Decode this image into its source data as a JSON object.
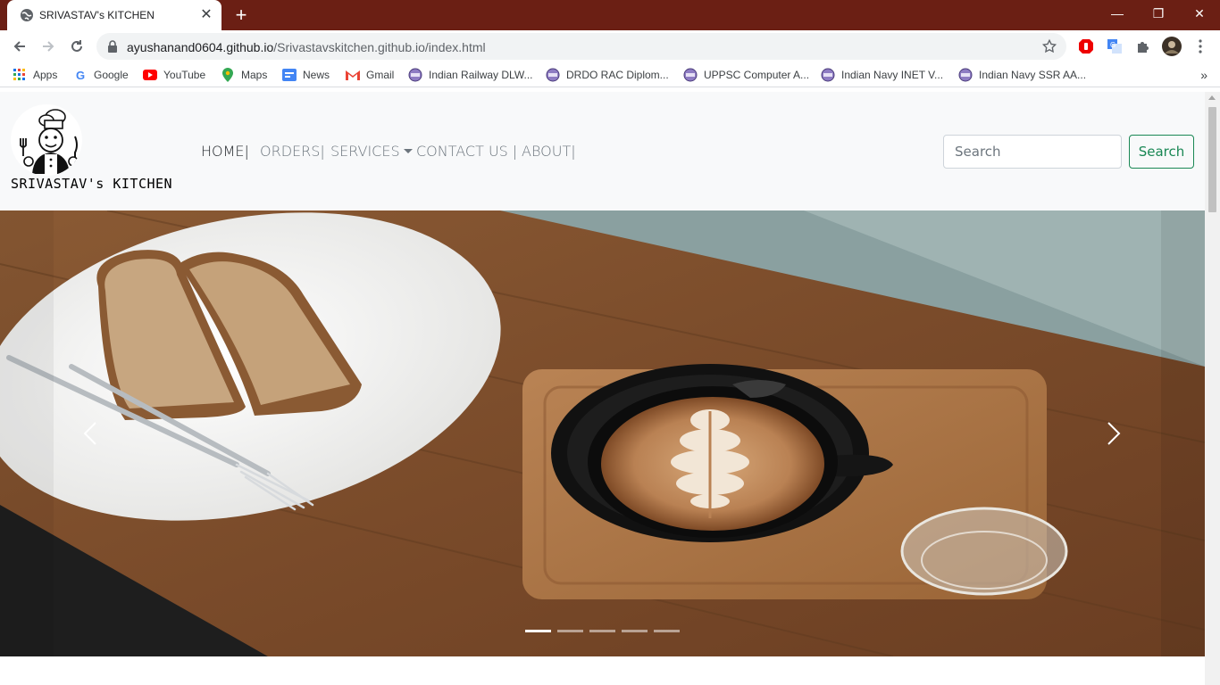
{
  "browser": {
    "tab_title": "SRIVASTAV's KITCHEN",
    "tab_close": "✕",
    "new_tab": "+",
    "url_host": "ayushanand0604.github.io",
    "url_path": "/Srivastavskitchen.github.io/index.html",
    "window_controls": [
      "—",
      "❐",
      "✕"
    ]
  },
  "bookmarks": [
    {
      "label": "Apps",
      "icon": "apps-grid-icon"
    },
    {
      "label": "Google",
      "icon": "google-icon"
    },
    {
      "label": "YouTube",
      "icon": "youtube-icon"
    },
    {
      "label": "Maps",
      "icon": "maps-icon"
    },
    {
      "label": "News",
      "icon": "news-icon"
    },
    {
      "label": "Gmail",
      "icon": "gmail-icon"
    },
    {
      "label": "Indian Railway DLW...",
      "icon": "globe-icon"
    },
    {
      "label": "DRDO RAC Diplom...",
      "icon": "globe-icon"
    },
    {
      "label": "UPPSC Computer A...",
      "icon": "globe-icon"
    },
    {
      "label": "Indian Navy INET V...",
      "icon": "globe-icon"
    },
    {
      "label": "Indian Navy SSR AA...",
      "icon": "globe-icon"
    }
  ],
  "bookmarks_more": "»",
  "site": {
    "brand": "SRIVASTAV's KITCHEN",
    "menu": {
      "home": "HOME|",
      "orders": "ORDERS|",
      "services": "SERVICES",
      "contact": "CONTACT US |",
      "about": "ABOUT|"
    },
    "search_placeholder": "Search",
    "search_button": "Search"
  },
  "carousel": {
    "slide_count": 5,
    "active_index": 0,
    "prev_icon": "chevron-left-icon",
    "next_icon": "chevron-right-icon"
  },
  "colors": {
    "tabstrip": "#6b1f14",
    "accent_green": "#198754",
    "nav_bg": "#f8f9fa"
  }
}
